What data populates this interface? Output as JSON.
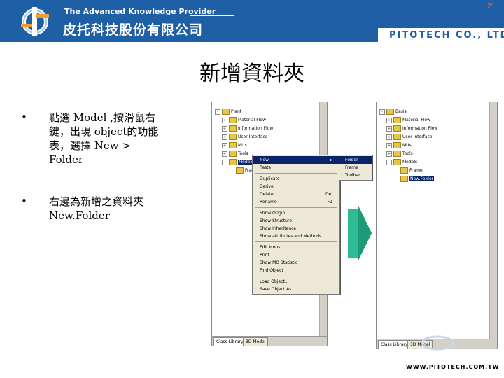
{
  "header": {
    "tagline": "The Advanced Knowledge Provider",
    "company_name_cn": "皮托科技股份有限公司",
    "company_name_en": "PITOTECH CO., LTD.",
    "page_number": "21"
  },
  "slide": {
    "title": "新增資料夾",
    "bullets": [
      "點選 Model ,按滑鼠右鍵，出現 object的功能表，選擇 New > Folder",
      "右邊為新增之資料夾New.Folder"
    ]
  },
  "left_window": {
    "tree": [
      {
        "label": "Plant",
        "expander": "-"
      },
      {
        "label": "Material Flow",
        "expander": "+"
      },
      {
        "label": "Information Flow",
        "expander": "+"
      },
      {
        "label": "User Interface",
        "expander": "+"
      },
      {
        "label": "MUs",
        "expander": "+"
      },
      {
        "label": "Tools",
        "expander": "+"
      },
      {
        "label": "Models",
        "expander": "-",
        "selected": true
      },
      {
        "label": "Frame",
        "expander": ""
      }
    ],
    "tabs": [
      "Class Library",
      "3D Model"
    ],
    "context_menu": [
      {
        "label": "New",
        "shortcut": "▸",
        "highlighted": true
      },
      {
        "label": "Paste",
        "shortcut": ""
      },
      {
        "sep": true
      },
      {
        "label": "Duplicate",
        "shortcut": ""
      },
      {
        "label": "Derive",
        "shortcut": ""
      },
      {
        "label": "Delete",
        "shortcut": "Del"
      },
      {
        "label": "Rename",
        "shortcut": "F2"
      },
      {
        "sep": true
      },
      {
        "label": "Show Origin",
        "shortcut": ""
      },
      {
        "label": "Show Structure",
        "shortcut": ""
      },
      {
        "label": "Show Inheritance",
        "shortcut": ""
      },
      {
        "label": "Show attributes and Methods",
        "shortcut": ""
      },
      {
        "sep": true
      },
      {
        "label": "Edit Icons...",
        "shortcut": ""
      },
      {
        "label": "Print",
        "shortcut": ""
      },
      {
        "label": "Show MO Statistic",
        "shortcut": ""
      },
      {
        "label": "Find Object",
        "shortcut": ""
      },
      {
        "sep": true
      },
      {
        "label": "Load Object...",
        "shortcut": ""
      },
      {
        "label": "Save Object As...",
        "shortcut": ""
      }
    ],
    "submenu": [
      {
        "label": "Folder",
        "highlighted": true
      },
      {
        "label": "Frame"
      },
      {
        "label": "Toolbar"
      }
    ]
  },
  "right_window": {
    "tree": [
      {
        "label": "Basis",
        "expander": "-",
        "indent": 0
      },
      {
        "label": "Material Flow",
        "expander": "+",
        "indent": 1
      },
      {
        "label": "Information Flow",
        "expander": "+",
        "indent": 1
      },
      {
        "label": "User Interface",
        "expander": "+",
        "indent": 1
      },
      {
        "label": "MUs",
        "expander": "+",
        "indent": 1
      },
      {
        "label": "Tools",
        "expander": "+",
        "indent": 1
      },
      {
        "label": "Models",
        "expander": "-",
        "indent": 1
      },
      {
        "label": "Frame",
        "expander": "",
        "indent": 2
      },
      {
        "label": "New.Folder",
        "expander": "",
        "indent": 2,
        "selected": true
      }
    ],
    "tabs": [
      "Class Library",
      "3D Model"
    ]
  },
  "footer": {
    "url": "WWW.PITOTECH.COM.TW"
  },
  "colors": {
    "header_blue": "#1f5fa6",
    "arrow_green": "#2ebc94",
    "selection": "#0a246a"
  }
}
